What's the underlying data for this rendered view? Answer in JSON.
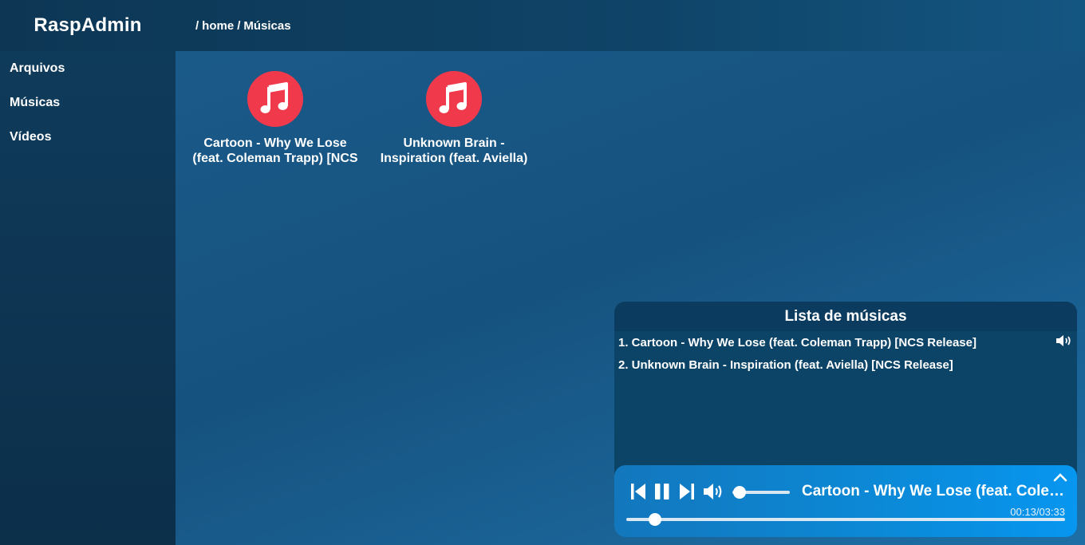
{
  "app": {
    "title": "RaspAdmin"
  },
  "breadcrumb": {
    "sep1": "/",
    "home": "home",
    "sep2": "/",
    "current": "Músicas"
  },
  "sidebar": {
    "items": [
      {
        "label": "Arquivos"
      },
      {
        "label": "Músicas"
      },
      {
        "label": "Vídeos"
      }
    ]
  },
  "files": [
    {
      "name": "Cartoon - Why We Lose (feat. Coleman Trapp) [NCS",
      "icon": "music-note-icon"
    },
    {
      "name": "Unknown Brain - Inspiration (feat. Aviella) [NCS",
      "icon": "music-note-icon"
    }
  ],
  "playlist": {
    "title": "Lista de músicas",
    "tracks": [
      {
        "label": "1. Cartoon - Why We Lose (feat. Coleman Trapp) [NCS Release]",
        "playing": true
      },
      {
        "label": "2. Unknown Brain - Inspiration (feat. Aviella) [NCS Release]",
        "playing": false
      }
    ]
  },
  "player": {
    "now_playing": "Cartoon - Why We Lose (feat. Coleman Trapp) [NCS Release]",
    "current_time": "00:13",
    "time_sep": "/",
    "duration": "03:33",
    "progress_fraction": 0.065,
    "volume_fraction": 0.1
  },
  "colors": {
    "accent": "#f03a4b",
    "player_gradient_start": "#1377bd",
    "player_gradient_end": "#0796f0"
  }
}
